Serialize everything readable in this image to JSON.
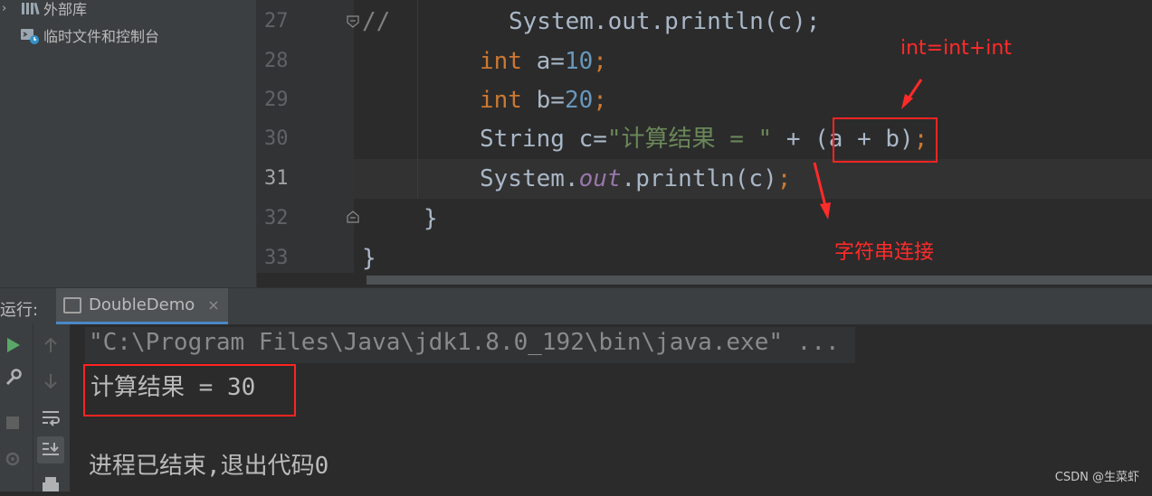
{
  "sidebar": {
    "items": [
      {
        "label": "外部库",
        "icon": "library-icon"
      },
      {
        "label": "临时文件和控制台",
        "icon": "scratches-icon"
      }
    ]
  },
  "editor": {
    "line_numbers": [
      "27",
      "28",
      "29",
      "30",
      "31",
      "32",
      "33"
    ],
    "active_line": "31",
    "code": {
      "l27_comment": "//",
      "l27_rest": "System.out.println(c);",
      "l28_kw": "int",
      "l28_a": " a=",
      "l28_num": "10",
      "l28_semi": ";",
      "l29_kw": "int",
      "l29_b": " b=",
      "l29_num": "20",
      "l29_semi": ";",
      "l30_a": "String c=",
      "l30_str": "\"计算结果 = \"",
      "l30_b": " + (a + b)",
      "l30_semi": ";",
      "l31_a": "System.",
      "l31_field": "out",
      "l31_b": ".println(c)",
      "l31_semi": ";",
      "l32": "}",
      "l33": "}"
    }
  },
  "annotations": {
    "top": "int=int+int",
    "bottom": "字符串连接"
  },
  "run": {
    "label": "运行:",
    "tab_label": "DoubleDemo",
    "tab_close": "×",
    "output": {
      "command": "\"C:\\Program Files\\Java\\jdk1.8.0_192\\bin\\java.exe\" ...",
      "result": "计算结果 = 30",
      "exit": "进程已结束,退出代码0"
    }
  },
  "watermark": "CSDN @生菜虾",
  "colors": {
    "keyword": "#cc7832",
    "number": "#6897bb",
    "string": "#6a8759",
    "annotation": "#ff2a2a"
  }
}
